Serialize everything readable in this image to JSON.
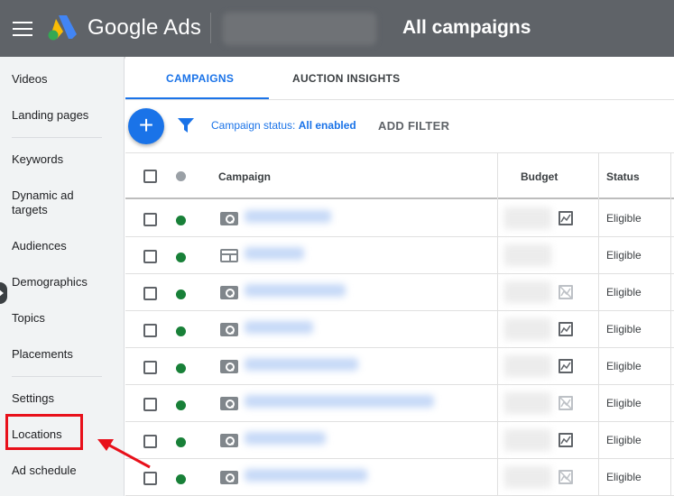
{
  "header": {
    "brand": "Google Ads",
    "title": "All campaigns"
  },
  "sidebar": {
    "items": [
      {
        "label": "Videos"
      },
      {
        "label": "Landing pages"
      },
      {
        "label": "Keywords"
      },
      {
        "label": "Dynamic ad targets"
      },
      {
        "label": "Audiences"
      },
      {
        "label": "Demographics"
      },
      {
        "label": "Topics"
      },
      {
        "label": "Placements"
      },
      {
        "label": "Settings"
      },
      {
        "label": "Locations"
      },
      {
        "label": "Ad schedule"
      }
    ]
  },
  "tabs": [
    {
      "label": "CAMPAIGNS",
      "active": true
    },
    {
      "label": "AUCTION INSIGHTS",
      "active": false
    }
  ],
  "filter": {
    "label": "Campaign status: ",
    "value": "All enabled",
    "add_filter": "ADD FILTER"
  },
  "table": {
    "columns": [
      "Campaign",
      "Budget",
      "Status"
    ],
    "rows": [
      {
        "type": "search",
        "status": "Eligible",
        "chart": "on"
      },
      {
        "type": "display",
        "status": "Eligible",
        "chart": "none"
      },
      {
        "type": "search",
        "status": "Eligible",
        "chart": "off"
      },
      {
        "type": "search",
        "status": "Eligible",
        "chart": "on"
      },
      {
        "type": "search",
        "status": "Eligible",
        "chart": "on"
      },
      {
        "type": "search",
        "status": "Eligible",
        "chart": "off"
      },
      {
        "type": "search",
        "status": "Eligible",
        "chart": "on"
      },
      {
        "type": "search",
        "status": "Eligible",
        "chart": "off"
      }
    ]
  },
  "colors": {
    "header_bg": "#5f6368",
    "accent": "#1a73e8",
    "status_green": "#188038",
    "highlight_red": "#e8101a"
  }
}
